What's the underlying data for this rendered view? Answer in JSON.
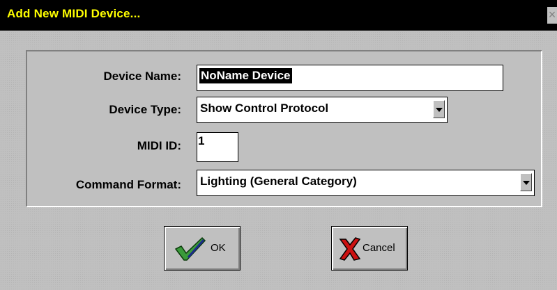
{
  "window": {
    "title": "Add New MIDI Device...",
    "close_glyph": "×"
  },
  "form": {
    "device_name_label": "Device Name:",
    "device_name_value": "NoName Device",
    "device_type_label": "Device Type:",
    "device_type_value": "Show Control Protocol",
    "midi_id_label": "MIDI ID:",
    "midi_id_value": "1",
    "command_format_label": "Command Format:",
    "command_format_value": "Lighting (General Category)"
  },
  "buttons": {
    "ok_label": "OK",
    "cancel_label": "Cancel"
  },
  "icons": {
    "ok": "checkmark-icon",
    "cancel": "red-x-icon",
    "dropdown": "chevron-down-icon"
  },
  "colors": {
    "title_bar": "#000000",
    "title_text": "#ffff00",
    "face": "#c0c0c0",
    "check_green": "#3a9a3a",
    "cancel_red": "#cc1111"
  }
}
